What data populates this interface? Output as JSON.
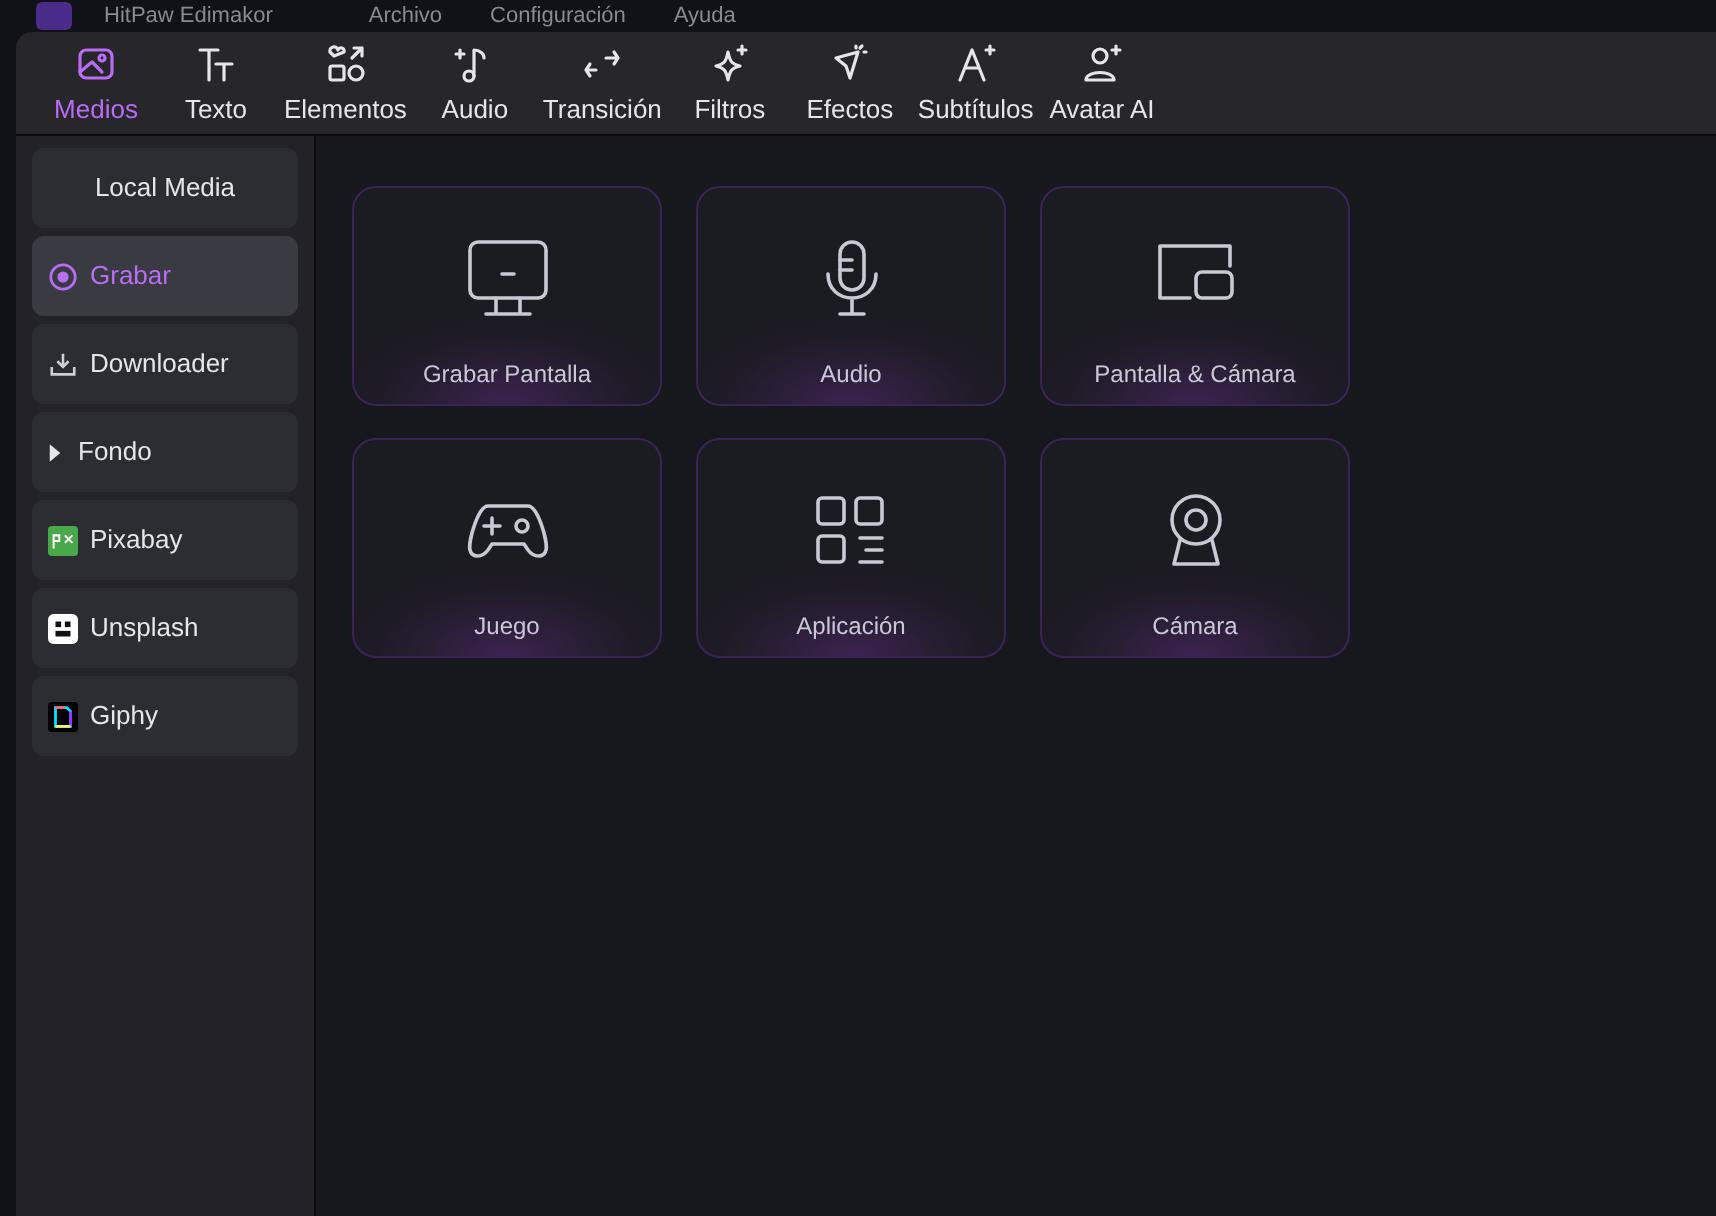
{
  "title_bar": {
    "app_name": "HitPaw Edimakor",
    "menu": [
      "Archivo",
      "Configuración",
      "Ayuda"
    ]
  },
  "toolbar": {
    "tabs": [
      {
        "label": "Medios",
        "selected": true
      },
      {
        "label": "Texto",
        "selected": false
      },
      {
        "label": "Elementos",
        "selected": false
      },
      {
        "label": "Audio",
        "selected": false
      },
      {
        "label": "Transición",
        "selected": false
      },
      {
        "label": "Filtros",
        "selected": false
      },
      {
        "label": "Efectos",
        "selected": false
      },
      {
        "label": "Subtítulos",
        "selected": false
      },
      {
        "label": "Avatar AI",
        "selected": false
      }
    ]
  },
  "sidebar": {
    "items": [
      {
        "label": "Local Media",
        "kind": "plain",
        "selected": false
      },
      {
        "label": "Grabar",
        "kind": "icon",
        "selected": true
      },
      {
        "label": "Downloader",
        "kind": "icon",
        "selected": false
      },
      {
        "label": "Fondo",
        "kind": "folder",
        "expanded": false,
        "selected": false
      },
      {
        "label": "Pixabay",
        "kind": "icon",
        "selected": false
      },
      {
        "label": "Unsplash",
        "kind": "icon",
        "selected": false
      },
      {
        "label": "Giphy",
        "kind": "icon",
        "selected": false
      }
    ]
  },
  "record_options": [
    {
      "label": "Grabar Pantalla"
    },
    {
      "label": "Audio"
    },
    {
      "label": "Pantalla & Cámara"
    },
    {
      "label": "Juego"
    },
    {
      "label": "Aplicación"
    },
    {
      "label": "Cámara"
    }
  ]
}
